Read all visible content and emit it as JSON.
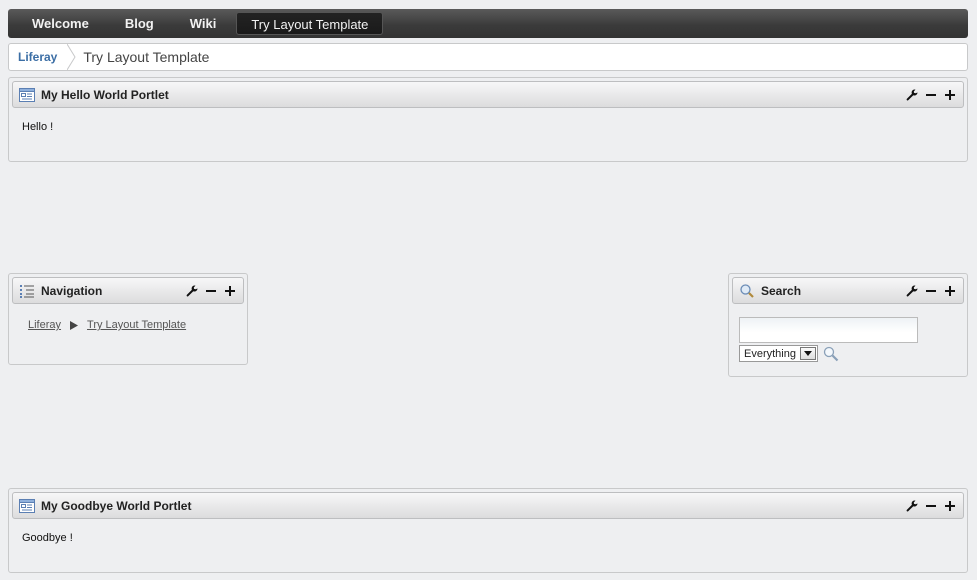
{
  "nav": {
    "items": [
      {
        "label": "Welcome"
      },
      {
        "label": "Blog"
      },
      {
        "label": "Wiki"
      },
      {
        "label": "Try Layout Template"
      }
    ]
  },
  "breadcrumb": {
    "home": "Liferay",
    "current": "Try Layout Template"
  },
  "portlets": {
    "hello": {
      "title": "My Hello World Portlet",
      "content": "Hello !"
    },
    "navigation": {
      "title": "Navigation",
      "links": [
        "Liferay",
        "Try Layout Template"
      ]
    },
    "search": {
      "title": "Search",
      "query": "",
      "scope": "Everything"
    },
    "goodbye": {
      "title": "My Goodbye World Portlet",
      "content": "Goodbye !"
    }
  },
  "icons": {
    "portlet": "portlet-window-icon",
    "navigation": "list-icon",
    "search": "magnifier-icon",
    "configure": "wrench-icon",
    "minimize": "minus-icon",
    "maximize": "plus-icon"
  },
  "colors": {
    "navbar": "#3b3b3b",
    "link": "#3b6ea5",
    "background": "#eeeff1"
  }
}
